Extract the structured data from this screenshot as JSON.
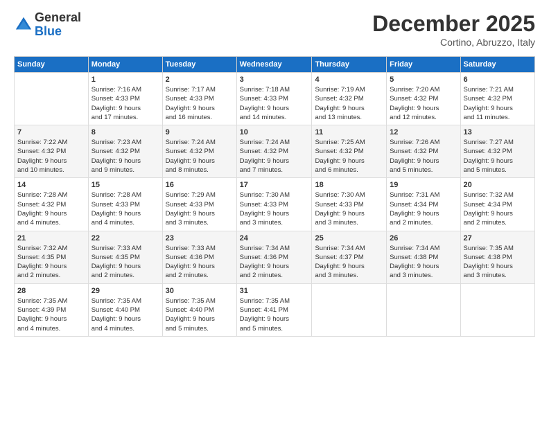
{
  "logo": {
    "line1": "General",
    "line2": "Blue"
  },
  "header": {
    "month": "December 2025",
    "location": "Cortino, Abruzzo, Italy"
  },
  "days_of_week": [
    "Sunday",
    "Monday",
    "Tuesday",
    "Wednesday",
    "Thursday",
    "Friday",
    "Saturday"
  ],
  "weeks": [
    [
      {
        "num": "",
        "info": ""
      },
      {
        "num": "1",
        "info": "Sunrise: 7:16 AM\nSunset: 4:33 PM\nDaylight: 9 hours\nand 17 minutes."
      },
      {
        "num": "2",
        "info": "Sunrise: 7:17 AM\nSunset: 4:33 PM\nDaylight: 9 hours\nand 16 minutes."
      },
      {
        "num": "3",
        "info": "Sunrise: 7:18 AM\nSunset: 4:33 PM\nDaylight: 9 hours\nand 14 minutes."
      },
      {
        "num": "4",
        "info": "Sunrise: 7:19 AM\nSunset: 4:32 PM\nDaylight: 9 hours\nand 13 minutes."
      },
      {
        "num": "5",
        "info": "Sunrise: 7:20 AM\nSunset: 4:32 PM\nDaylight: 9 hours\nand 12 minutes."
      },
      {
        "num": "6",
        "info": "Sunrise: 7:21 AM\nSunset: 4:32 PM\nDaylight: 9 hours\nand 11 minutes."
      }
    ],
    [
      {
        "num": "7",
        "info": "Sunrise: 7:22 AM\nSunset: 4:32 PM\nDaylight: 9 hours\nand 10 minutes."
      },
      {
        "num": "8",
        "info": "Sunrise: 7:23 AM\nSunset: 4:32 PM\nDaylight: 9 hours\nand 9 minutes."
      },
      {
        "num": "9",
        "info": "Sunrise: 7:24 AM\nSunset: 4:32 PM\nDaylight: 9 hours\nand 8 minutes."
      },
      {
        "num": "10",
        "info": "Sunrise: 7:24 AM\nSunset: 4:32 PM\nDaylight: 9 hours\nand 7 minutes."
      },
      {
        "num": "11",
        "info": "Sunrise: 7:25 AM\nSunset: 4:32 PM\nDaylight: 9 hours\nand 6 minutes."
      },
      {
        "num": "12",
        "info": "Sunrise: 7:26 AM\nSunset: 4:32 PM\nDaylight: 9 hours\nand 5 minutes."
      },
      {
        "num": "13",
        "info": "Sunrise: 7:27 AM\nSunset: 4:32 PM\nDaylight: 9 hours\nand 5 minutes."
      }
    ],
    [
      {
        "num": "14",
        "info": "Sunrise: 7:28 AM\nSunset: 4:32 PM\nDaylight: 9 hours\nand 4 minutes."
      },
      {
        "num": "15",
        "info": "Sunrise: 7:28 AM\nSunset: 4:33 PM\nDaylight: 9 hours\nand 4 minutes."
      },
      {
        "num": "16",
        "info": "Sunrise: 7:29 AM\nSunset: 4:33 PM\nDaylight: 9 hours\nand 3 minutes."
      },
      {
        "num": "17",
        "info": "Sunrise: 7:30 AM\nSunset: 4:33 PM\nDaylight: 9 hours\nand 3 minutes."
      },
      {
        "num": "18",
        "info": "Sunrise: 7:30 AM\nSunset: 4:33 PM\nDaylight: 9 hours\nand 3 minutes."
      },
      {
        "num": "19",
        "info": "Sunrise: 7:31 AM\nSunset: 4:34 PM\nDaylight: 9 hours\nand 2 minutes."
      },
      {
        "num": "20",
        "info": "Sunrise: 7:32 AM\nSunset: 4:34 PM\nDaylight: 9 hours\nand 2 minutes."
      }
    ],
    [
      {
        "num": "21",
        "info": "Sunrise: 7:32 AM\nSunset: 4:35 PM\nDaylight: 9 hours\nand 2 minutes."
      },
      {
        "num": "22",
        "info": "Sunrise: 7:33 AM\nSunset: 4:35 PM\nDaylight: 9 hours\nand 2 minutes."
      },
      {
        "num": "23",
        "info": "Sunrise: 7:33 AM\nSunset: 4:36 PM\nDaylight: 9 hours\nand 2 minutes."
      },
      {
        "num": "24",
        "info": "Sunrise: 7:34 AM\nSunset: 4:36 PM\nDaylight: 9 hours\nand 2 minutes."
      },
      {
        "num": "25",
        "info": "Sunrise: 7:34 AM\nSunset: 4:37 PM\nDaylight: 9 hours\nand 3 minutes."
      },
      {
        "num": "26",
        "info": "Sunrise: 7:34 AM\nSunset: 4:38 PM\nDaylight: 9 hours\nand 3 minutes."
      },
      {
        "num": "27",
        "info": "Sunrise: 7:35 AM\nSunset: 4:38 PM\nDaylight: 9 hours\nand 3 minutes."
      }
    ],
    [
      {
        "num": "28",
        "info": "Sunrise: 7:35 AM\nSunset: 4:39 PM\nDaylight: 9 hours\nand 4 minutes."
      },
      {
        "num": "29",
        "info": "Sunrise: 7:35 AM\nSunset: 4:40 PM\nDaylight: 9 hours\nand 4 minutes."
      },
      {
        "num": "30",
        "info": "Sunrise: 7:35 AM\nSunset: 4:40 PM\nDaylight: 9 hours\nand 5 minutes."
      },
      {
        "num": "31",
        "info": "Sunrise: 7:35 AM\nSunset: 4:41 PM\nDaylight: 9 hours\nand 5 minutes."
      },
      {
        "num": "",
        "info": ""
      },
      {
        "num": "",
        "info": ""
      },
      {
        "num": "",
        "info": ""
      }
    ]
  ]
}
